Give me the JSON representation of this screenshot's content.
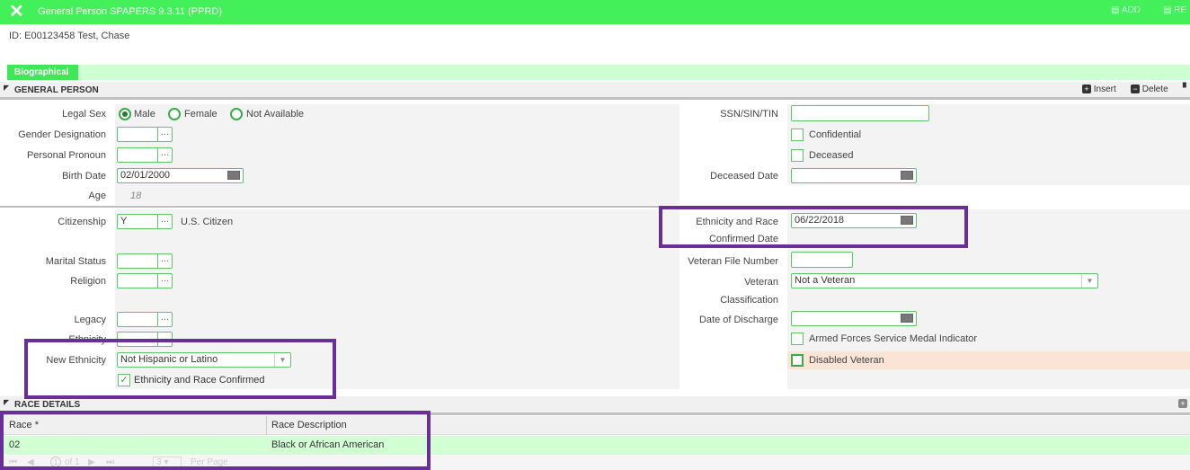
{
  "titlebar": {
    "title": "General Person SPAPERS 9.3.11 (PPRD)",
    "add_label": "ADD",
    "re_label": "RE"
  },
  "idline": {
    "text": "ID: E00123458 Test, Chase"
  },
  "tabs": {
    "biographical": "Biographical"
  },
  "general_person": {
    "header": "GENERAL PERSON",
    "insert_label": "Insert",
    "delete_label": "Delete",
    "legal_sex_label": "Legal Sex",
    "sex_options": [
      "Male",
      "Female",
      "Not Available"
    ],
    "gender_designation_label": "Gender Designation",
    "personal_pronoun_label": "Personal Pronoun",
    "birth_date_label": "Birth Date",
    "birth_date_value": "02/01/2000",
    "age_label": "Age",
    "age_value": "18",
    "citizenship_label": "Citizenship",
    "citizenship_value": "Y",
    "citizenship_desc": "U.S. Citizen",
    "marital_status_label": "Marital Status",
    "religion_label": "Religion",
    "legacy_label": "Legacy",
    "ethnicity_label": "Ethnicity",
    "new_ethnicity_label": "New Ethnicity",
    "new_ethnicity_value": "Not Hispanic or Latino",
    "eth_race_confirmed_label": "Ethnicity and Race Confirmed",
    "ssn_label": "SSN/SIN/TIN",
    "confidential_label": "Confidential",
    "deceased_label": "Deceased",
    "deceased_date_label": "Deceased Date",
    "eth_race_confirmed_date_label_1": "Ethnicity and Race",
    "eth_race_confirmed_date_label_2": "Confirmed Date",
    "eth_race_confirmed_date_value": "06/22/2018",
    "veteran_file_label": "Veteran File Number",
    "veteran_label_1": "Veteran",
    "veteran_label_2": "Classification",
    "veteran_value": "Not a Veteran",
    "date_of_discharge_label": "Date of Discharge",
    "armed_forces_label": "Armed Forces Service Medal Indicator",
    "disabled_veteran_label": "Disabled Veteran"
  },
  "race_details": {
    "header": "RACE DETAILS",
    "columns": [
      "Race *",
      "Race Description"
    ],
    "rows": [
      [
        "02",
        "Black or African American"
      ]
    ],
    "pager_text": "of 1",
    "page_num": "1",
    "per_page_value": "3",
    "per_page_label": "Per Page"
  },
  "colors": {
    "accent": "#43f05a",
    "highlight": "#6a2e9a"
  }
}
